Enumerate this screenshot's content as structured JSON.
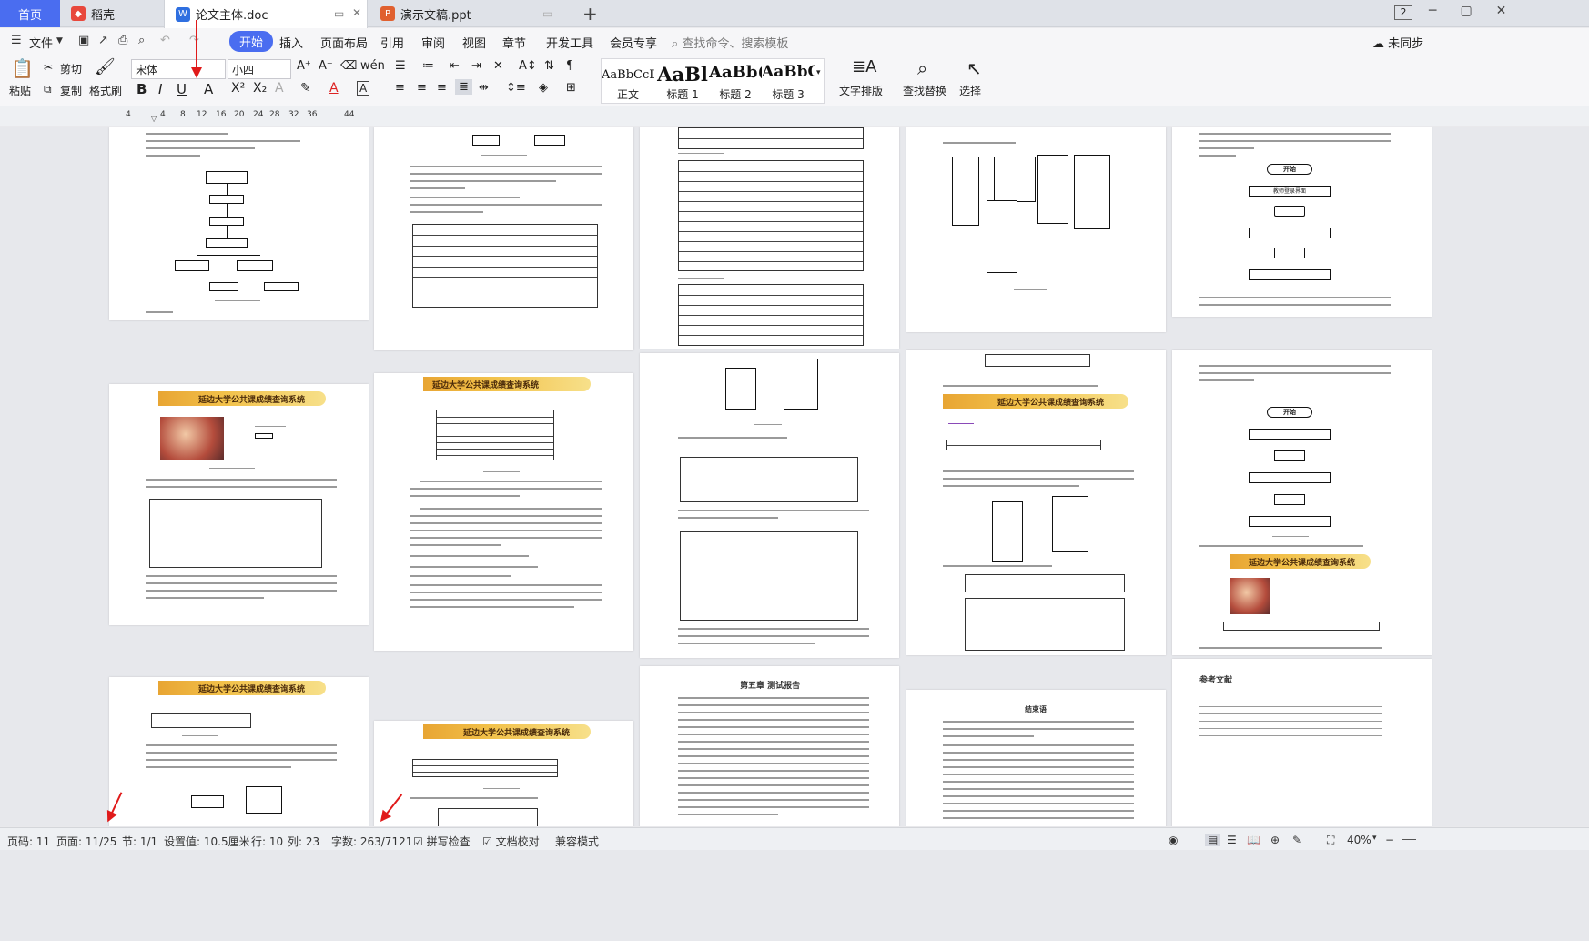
{
  "tabs": {
    "home": "首页",
    "daoke": "稻壳",
    "doc": "论文主体.doc",
    "ppt": "演示文稿.ppt",
    "window_count": "2"
  },
  "menu": {
    "file": "文件",
    "start": "开始",
    "insert": "插入",
    "layout": "页面布局",
    "reference": "引用",
    "review": "审阅",
    "view": "视图",
    "section": "章节",
    "developer": "开发工具",
    "member": "会员专享",
    "search_placeholder": "查找命令、搜索模板",
    "sync": "未同步"
  },
  "ribbon": {
    "paste": "粘贴",
    "cut": "剪切",
    "copy": "复制",
    "format_painter": "格式刷",
    "font_name": "宋体",
    "font_size": "小四",
    "styles": [
      {
        "sample": "AaBbCcD",
        "name": "正文"
      },
      {
        "sample": "AaBl",
        "name": "标题 1"
      },
      {
        "sample": "AaBb(",
        "name": "标题 2"
      },
      {
        "sample": "AaBbC",
        "name": "标题 3"
      }
    ],
    "text_layout": "文字排版",
    "find_replace": "查找替换",
    "select": "选择"
  },
  "ruler": {
    "ticks": [
      "4",
      "4",
      "8",
      "12",
      "16",
      "20",
      "24",
      "28",
      "32",
      "36",
      "44"
    ]
  },
  "pages": {
    "system_title": "延边大学公共课成绩查询系统",
    "chapter5_title": "第五章 测试报告",
    "conclusion_title": "结束语",
    "references_title": "参考文献",
    "flow_start": "开始",
    "flow_home": "教师登录界面"
  },
  "status": {
    "page_no": "页码: 11",
    "page_count": "页面: 11/25",
    "section": "节: 1/1",
    "setting": "设置值: 10.5厘米",
    "row": "行: 10",
    "col": "列: 23",
    "word_count": "字数: 263/7121",
    "spell_check": "拼写检查",
    "doc_check": "文档校对",
    "compat": "兼容模式",
    "zoom": "40%"
  }
}
